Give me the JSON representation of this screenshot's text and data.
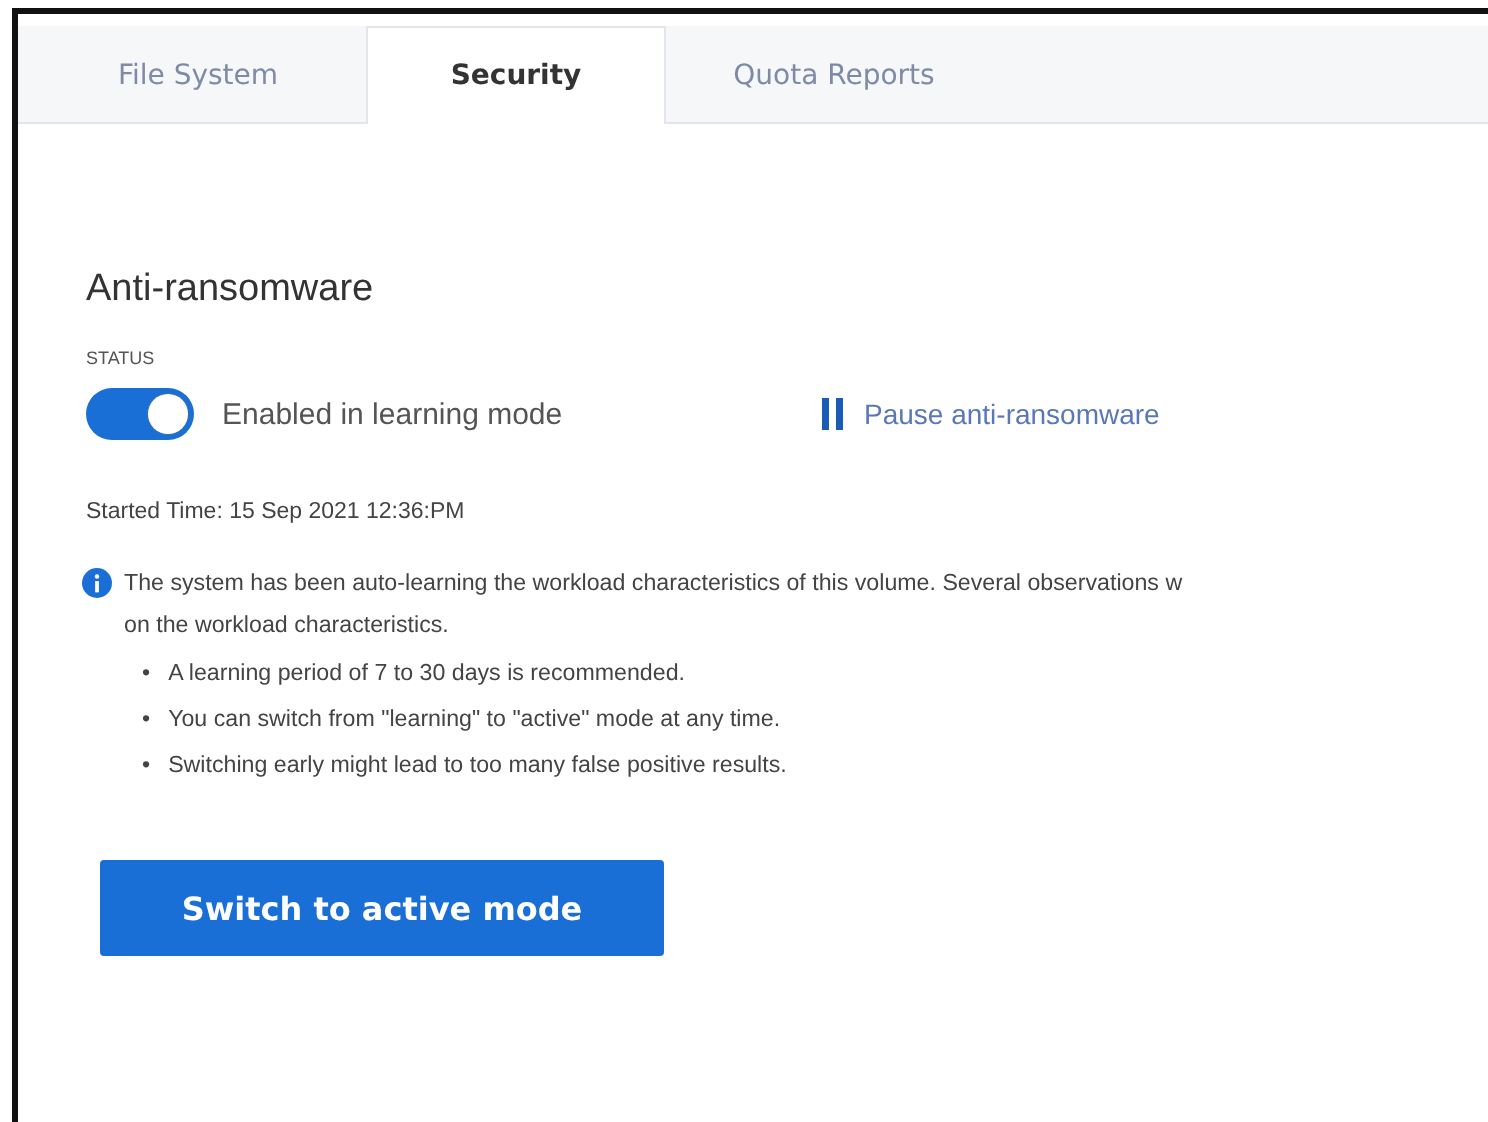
{
  "tabs": [
    {
      "label": "File System",
      "selected": false
    },
    {
      "label": "Security",
      "selected": true
    },
    {
      "label": "Quota Reports",
      "selected": false
    }
  ],
  "section": {
    "title": "Anti-ransomware",
    "status_label": "STATUS",
    "toggle": {
      "on": true,
      "label": "Enabled in learning mode"
    },
    "pause_link": "Pause anti-ransomware",
    "started_time": "Started Time: 15 Sep 2021 12:36:PM",
    "info_lines": [
      "The system has been auto-learning the workload characteristics of this volume. Several observations w",
      "on the workload characteristics."
    ],
    "bullets": [
      {
        "marker": "•",
        "text": "A learning period of 7 to 30 days is recommended."
      },
      {
        "marker": "•",
        "text": "You can switch from \"learning\" to \"active\" mode at any time."
      },
      {
        "marker": "•",
        "text": "Switching early might lead to too many false positive results."
      }
    ],
    "button": "Switch to active mode"
  }
}
